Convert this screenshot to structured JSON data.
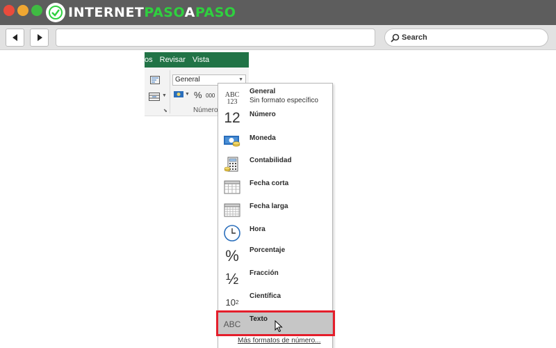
{
  "logo": {
    "part1": "INTERNET",
    "part2": "PASO",
    "part3": "A",
    "part4": "PASO"
  },
  "browser": {
    "search_placeholder": "Search"
  },
  "ribbon": {
    "tabs": [
      "os",
      "Revisar",
      "Vista"
    ],
    "format_combo_value": "General",
    "percent_symbol": "%",
    "thousands_symbol": "000",
    "group_label": "Número"
  },
  "dropdown": {
    "items": [
      {
        "label": "General",
        "sublabel": "Sin formato específico",
        "icon": "abc-123-icon"
      },
      {
        "label": "Número",
        "icon": "number-12-icon"
      },
      {
        "label": "Moneda",
        "icon": "currency-icon"
      },
      {
        "label": "Contabilidad",
        "icon": "accounting-icon"
      },
      {
        "label": "Fecha corta",
        "icon": "short-date-icon"
      },
      {
        "label": "Fecha larga",
        "icon": "long-date-icon"
      },
      {
        "label": "Hora",
        "icon": "clock-icon"
      },
      {
        "label": "Porcentaje",
        "icon": "percent-icon"
      },
      {
        "label": "Fracción",
        "icon": "fraction-icon"
      },
      {
        "label": "Científica",
        "icon": "scientific-icon"
      },
      {
        "label": "Texto",
        "icon": "text-abc-icon",
        "selected": true
      }
    ],
    "icon_text": {
      "abc": "ABC",
      "n123": "123",
      "twelve": "12",
      "percent": "%",
      "half": "½",
      "sci_base": "10",
      "sci_exp": "2",
      "text_abc": "ABC"
    },
    "more_formats": "Más formatos de número..."
  },
  "colors": {
    "excel_green": "#217346",
    "highlight_red": "#e41e2b",
    "logo_green": "#2fd03f",
    "titlebar": "#5d5d5d"
  }
}
